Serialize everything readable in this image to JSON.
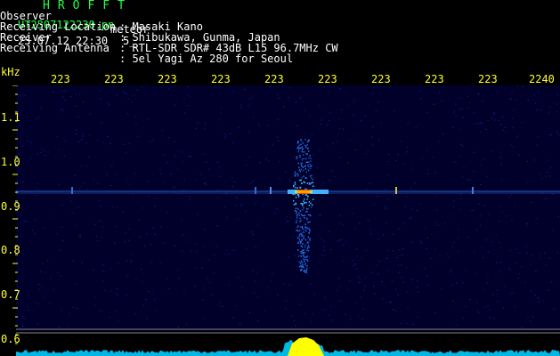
{
  "header": {
    "app_title": "HROFFT",
    "file_name": "UT2507122230.pn",
    "mode_label": "meteor",
    "datetime": "25.07.12 22:30",
    "slot": "5_",
    "info_rows": [
      {
        "label": "Observer",
        "value": ": Masaki Kano"
      },
      {
        "label": "Receiving Location",
        "value": ": Shibukawa, Gunma, Japan"
      },
      {
        "label": "Receiver",
        "value": ": RTL-SDR SDR# 43dB L15 96.7MHz CW"
      },
      {
        "label": "Receiving Antenna",
        "value": ": 5el Yagi Az 280 for Seoul"
      }
    ]
  },
  "axis": {
    "unit": "kHz",
    "time_ticks": [
      "223",
      "223",
      "223",
      "223",
      "223",
      "223",
      "223",
      "223",
      "223",
      "2240"
    ],
    "freq_ticks": [
      "1.1",
      "1.0",
      "0.9",
      "0.8",
      "0.7",
      "0.6"
    ]
  },
  "colors": {
    "label_green": "#22ff44",
    "axis_yellow": "#ffff33",
    "waterfall_bg": "#00002a",
    "spectrum_fill": "#00ccff",
    "spectrum_peak": "#ffff00",
    "echo_core": "#ff3300"
  }
}
